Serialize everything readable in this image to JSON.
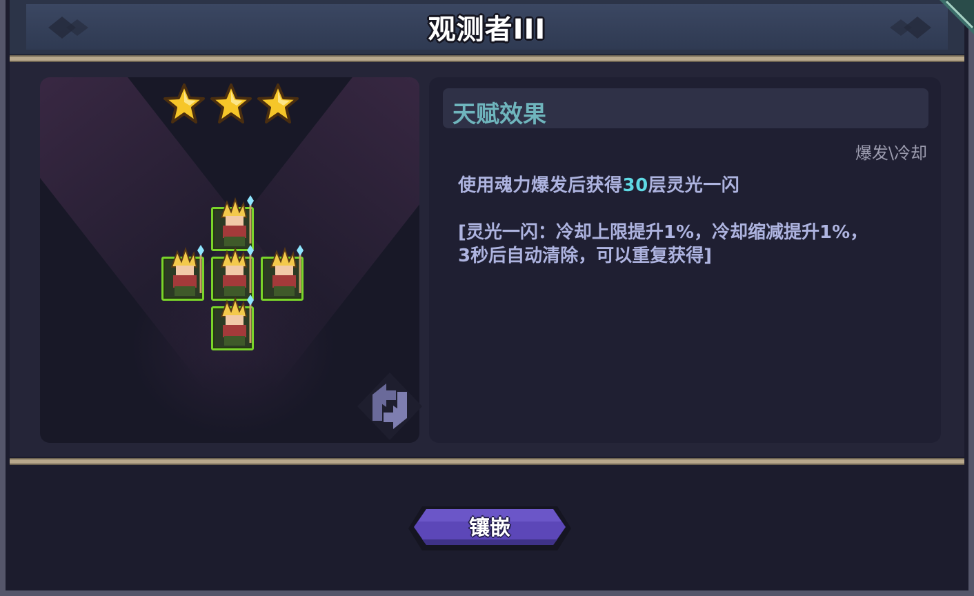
{
  "window": {
    "title": "观测者III"
  },
  "preview": {
    "star_count": 3,
    "star_color": "#f6c629",
    "unit_border_color": "#7ad42a",
    "unit_count": 5,
    "refresh_icon": "refresh-arrows-icon"
  },
  "talent": {
    "header_label": "天赋效果",
    "tags": "爆发\\冷却",
    "description_prefix": "使用魂力爆发后获得",
    "description_highlight": "30",
    "description_suffix": "层灵光一闪",
    "note_line1": "[灵光一闪：冷却上限提升1%，冷却缩减提升1%，",
    "note_line2": "3秒后自动清除，可以重复获得]",
    "highlight_color": "#5fd9e4"
  },
  "actions": {
    "embed_label": "镶嵌",
    "embed_color": "#5c47b8"
  }
}
